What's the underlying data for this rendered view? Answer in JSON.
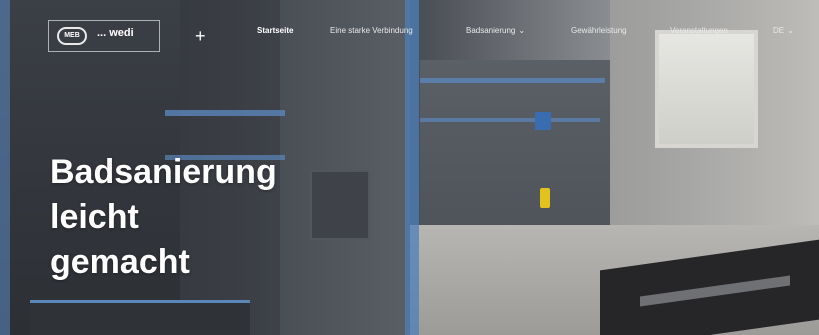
{
  "nav": {
    "logo_badge": "MEB",
    "logo_text": "... wedi",
    "items": [
      {
        "label": "Startseite",
        "active": true
      },
      {
        "label": "Eine starke Verbindung",
        "active": false
      },
      {
        "label": "Badsanierung",
        "active": false,
        "has_dropdown": true
      },
      {
        "label": "Gewährleistung",
        "active": false
      },
      {
        "label": "Veranstaltungen",
        "active": false
      }
    ],
    "language": "DE"
  },
  "hero": {
    "headline_lines": [
      "Badsanierung",
      "leicht",
      "gemacht"
    ]
  },
  "colors": {
    "accent_blue": "#4d7fb8",
    "text": "#ffffff"
  }
}
